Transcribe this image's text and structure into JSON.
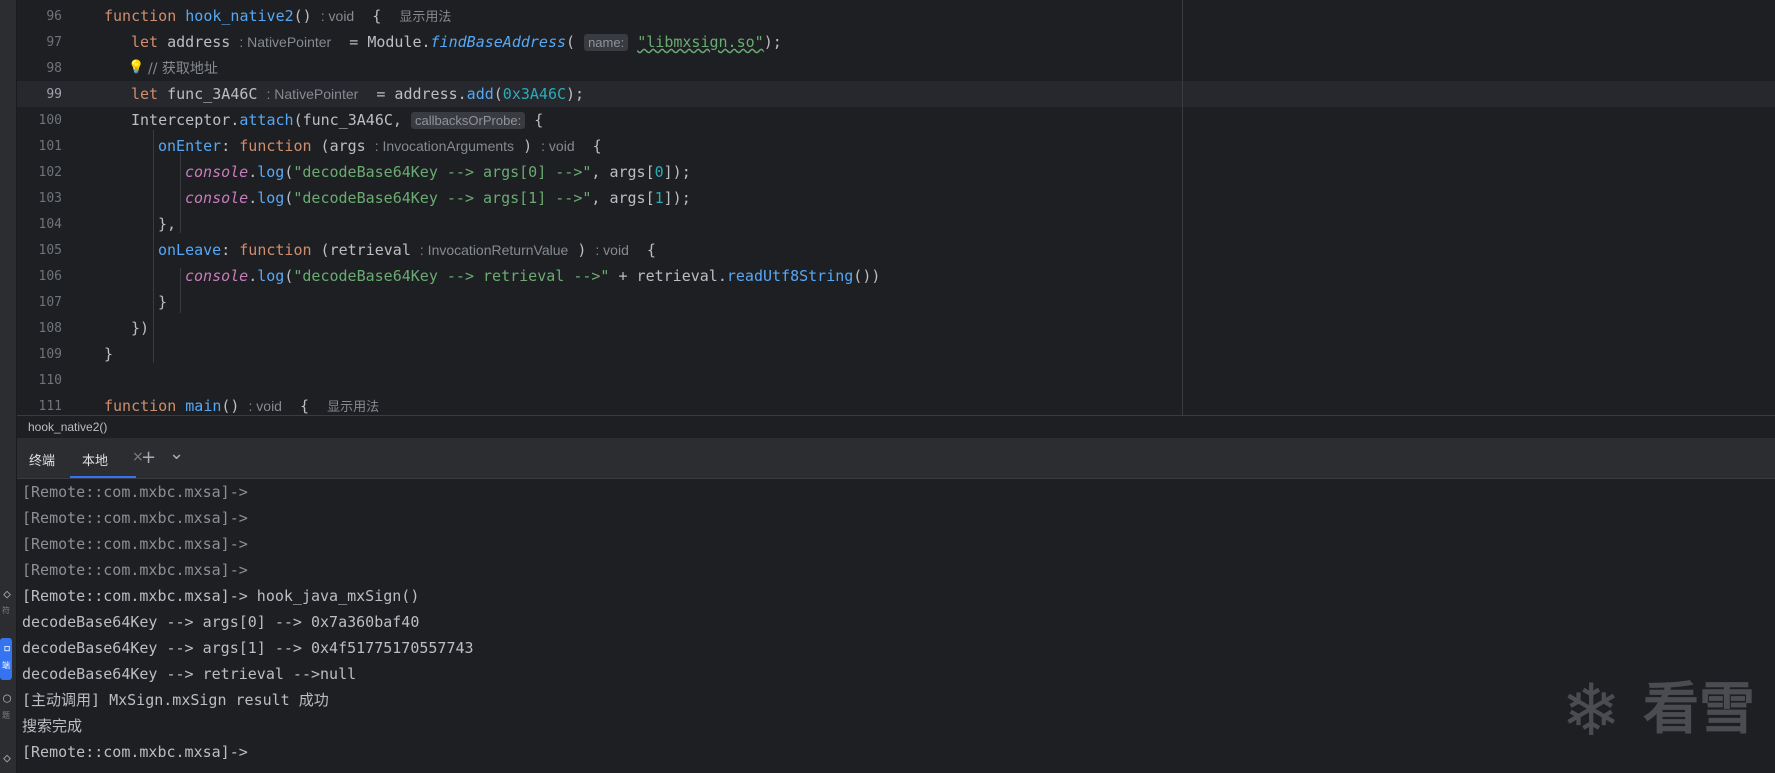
{
  "sidebar": {
    "labels": [
      "符",
      "端",
      "题",
      "务"
    ]
  },
  "editor": {
    "line_numbers": [
      "96",
      "97",
      "98",
      "99",
      "100",
      "101",
      "102",
      "103",
      "104",
      "105",
      "106",
      "107",
      "108",
      "109",
      "110",
      "111"
    ],
    "l96": {
      "kw": "function",
      "name": "hook_native2",
      "paren": "()",
      "hint": ": void",
      "brace": "{",
      "usage": "显示用法"
    },
    "l97": {
      "kw": "let",
      "var": "address",
      "hint": ": NativePointer",
      "eq": "= Module.",
      "method": "findBaseAddress",
      "open": "(",
      "param_hint": "name:",
      "str": "\"libmxsign.so\"",
      "close": ");"
    },
    "l98": {
      "comment": "// 获取地址"
    },
    "l99": {
      "kw": "let",
      "var": "func_3A46C",
      "hint": ": NativePointer",
      "eq": "= address.",
      "method": "add",
      "open": "(",
      "num": "0x3A46C",
      "close": ");"
    },
    "l100": {
      "obj": "Interceptor.",
      "method": "attach",
      "args": "(func_3A46C, ",
      "param_hint": "callbacksOrProbe:",
      "brace": "{"
    },
    "l101": {
      "prop": "onEnter",
      "colon": ": ",
      "kw": "function",
      "args": " (args",
      "hint": ": InvocationArguments",
      "close": ")",
      "ret": ": void",
      "brace": "{"
    },
    "l102": {
      "glob": "console",
      "dot": ".",
      "method": "log",
      "open": "(",
      "str": "\"decodeBase64Key --> args[0] -->\"",
      "mid": ", args[",
      "num": "0",
      "close": "]);"
    },
    "l103": {
      "glob": "console",
      "dot": ".",
      "method": "log",
      "open": "(",
      "str": "\"decodeBase64Key --> args[1] -->\"",
      "mid": ", args[",
      "num": "1",
      "close": "]);"
    },
    "l104": {
      "text": "},"
    },
    "l105": {
      "prop": "onLeave",
      "colon": ": ",
      "kw": "function",
      "args": " (retrieval",
      "hint": ": InvocationReturnValue",
      "close": ")",
      "ret": ": void",
      "brace": "{"
    },
    "l106": {
      "glob": "console",
      "dot": ".",
      "method": "log",
      "open": "(",
      "str": "\"decodeBase64Key --> retrieval -->\"",
      "mid": " + retrieval.",
      "method2": "readUtf8String",
      "close": "())"
    },
    "l107": {
      "text": "}"
    },
    "l108": {
      "text": "})"
    },
    "l109": {
      "text": "}"
    },
    "l111": {
      "kw": "function",
      "name": "main",
      "paren": "()",
      "hint": ": void",
      "brace": "{",
      "usage": "显示用法"
    }
  },
  "breadcrumb": "hook_native2()",
  "terminal": {
    "title": "终端",
    "tab_label": "本地",
    "close": "×",
    "add": "+",
    "dropdown": "⌄",
    "lines": [
      "[Remote::com.mxbc.mxsa]->",
      "[Remote::com.mxbc.mxsa]->",
      "[Remote::com.mxbc.mxsa]->",
      "[Remote::com.mxbc.mxsa]->",
      "[Remote::com.mxbc.mxsa]-> hook_java_mxSign()",
      "decodeBase64Key --> args[0] --> 0x7a360baf40",
      "decodeBase64Key --> args[1] --> 0x4f51775170557743",
      "decodeBase64Key --> retrieval -->null",
      "[主动调用] MxSign.mxSign result 成功",
      "搜索完成",
      "[Remote::com.mxbc.mxsa]->"
    ]
  },
  "watermark": {
    "text": "看雪"
  },
  "icons": [
    "code-icon",
    "terminal-icon",
    "problems-icon",
    "services-icon",
    "bulb-icon",
    "close-icon",
    "plus-icon",
    "chevron-down-icon",
    "snowflake-logo-icon"
  ],
  "colors": {
    "keyword": "#cf8e6d",
    "function": "#56a8f5",
    "string": "#6aab73",
    "number": "#2aacb8",
    "global": "#c77dbb",
    "accent": "#3574f0",
    "background": "#1e1f22"
  }
}
